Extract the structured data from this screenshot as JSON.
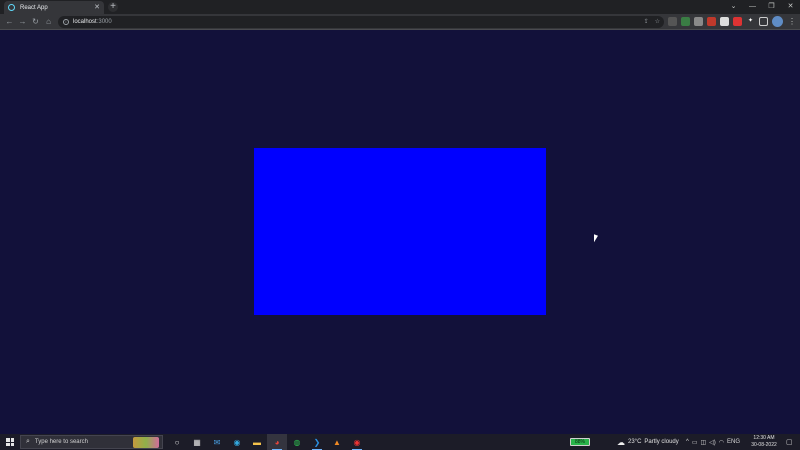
{
  "browser": {
    "tab_title": "React App",
    "tab_close": "✕",
    "new_tab": "+",
    "url_host": "localhost",
    "url_port": ":3000",
    "window_controls": [
      "⌄",
      "—",
      "❐",
      "✕"
    ]
  },
  "page": {
    "panel_color": "#0000ff",
    "background_color": "#12113a"
  },
  "taskbar": {
    "search_placeholder": "Type here to search",
    "battery_percent": "88%",
    "temperature": "23°C",
    "weather": "Partly cloudy",
    "language": "ENG",
    "time": "12:30 AM",
    "date": "30-08-2022"
  }
}
